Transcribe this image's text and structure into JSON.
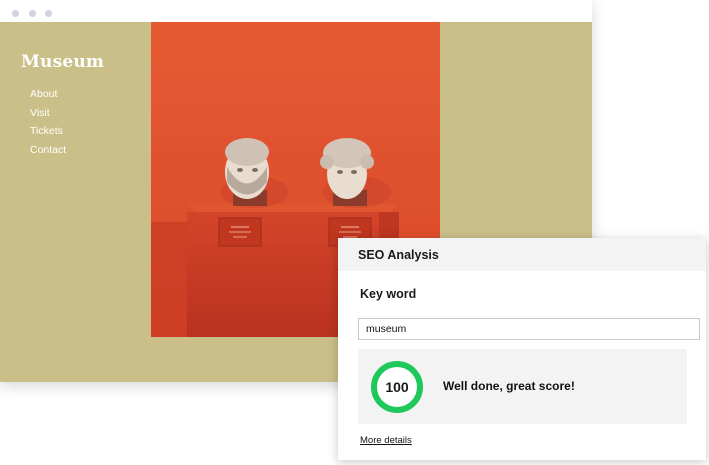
{
  "site": {
    "title": "Museum",
    "nav": [
      "About",
      "Visit",
      "Tickets",
      "Contact"
    ],
    "background_color": "#cbbf89"
  },
  "hero_image": {
    "description_icon": "sculpture-photo",
    "background_color": "#e0532c"
  },
  "seo_panel": {
    "title": "SEO Analysis",
    "keyword_label": "Key word",
    "keyword_value": "museum",
    "score": "100",
    "score_fraction": 1.0,
    "score_color": "#1ec85a",
    "message": "Well done, great score!",
    "more_details_link": "More details"
  }
}
